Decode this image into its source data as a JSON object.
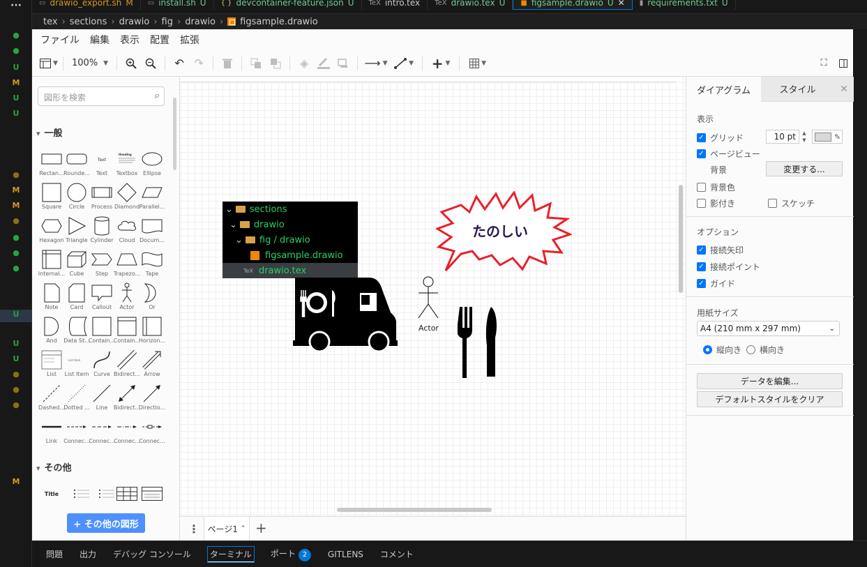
{
  "activity_bar": {
    "markers": [
      {
        "label": "●",
        "color": "#2ea043"
      },
      {
        "label": "●",
        "color": "#2ea043"
      },
      {
        "label": "U",
        "color": "#2ea043"
      },
      {
        "label": "M",
        "color": "#d29922"
      },
      {
        "label": "U",
        "color": "#2ea043"
      },
      {
        "label": "U",
        "color": "#2ea043"
      },
      {
        "label": "●",
        "color": "#8a6d1e"
      },
      {
        "label": "M",
        "color": "#d29922"
      },
      {
        "label": "M",
        "color": "#d29922"
      },
      {
        "label": "●",
        "color": "#8a6d1e"
      },
      {
        "label": "●",
        "color": "#2ea043"
      },
      {
        "label": "●",
        "color": "#2ea043"
      },
      {
        "label": "●",
        "color": "#2ea043"
      },
      {
        "label": "U",
        "color": "#2ea043"
      },
      {
        "label": "U",
        "color": "#2ea043"
      },
      {
        "label": "U",
        "color": "#2ea043"
      },
      {
        "label": "●",
        "color": "#8a6d1e"
      },
      {
        "label": "●",
        "color": "#8a6d1e"
      },
      {
        "label": "●",
        "color": "#8a6d1e"
      },
      {
        "label": "M",
        "color": "#d29922"
      }
    ],
    "more_label": "···"
  },
  "tabs": [
    {
      "icon": "shell-icon",
      "name": "drawio_export.sh",
      "status": "M",
      "color": "#d29922"
    },
    {
      "icon": "shell-icon",
      "name": "install.sh",
      "status": "U",
      "color": "#73c991"
    },
    {
      "icon": "json-icon",
      "name": "devcontainer-feature.json",
      "status": "U",
      "color": "#73c991"
    },
    {
      "icon": "tex-icon",
      "name": "intro.tex",
      "status": "",
      "color": "#cccccc"
    },
    {
      "icon": "tex-icon",
      "name": "drawio.tex",
      "status": "U",
      "color": "#73c991"
    },
    {
      "icon": "drawio-icon",
      "name": "figsample.drawio",
      "status": "U",
      "color": "#73c991",
      "active": true
    },
    {
      "icon": "txt-icon",
      "name": "requirements.txt",
      "status": "U",
      "color": "#73c991"
    }
  ],
  "breadcrumb": [
    "tex",
    "sections",
    "drawio",
    "fig",
    "drawio",
    "figsample.drawio"
  ],
  "menu": [
    "ファイル",
    "編集",
    "表示",
    "配置",
    "拡張"
  ],
  "toolbar": {
    "zoom": "100%"
  },
  "search": {
    "placeholder": "図形を検索"
  },
  "sections": {
    "general": "一般",
    "other": "その他"
  },
  "shapes": [
    "Rectan...",
    "Rounde...",
    "Text",
    "Textbox",
    "Ellipse",
    "Square",
    "Circle",
    "Process",
    "Diamond",
    "Parallel...",
    "Hexagon",
    "Triangle",
    "Cylinder",
    "Cloud",
    "Docum...",
    "Internal...",
    "Cube",
    "Step",
    "Trapezo...",
    "Tape",
    "Note",
    "Card",
    "Callout",
    "Actor",
    "Or",
    "And",
    "Data St...",
    "Contain...",
    "Contain...",
    "Horizon...",
    "List",
    "List Item",
    "Curve",
    "Bidirect...",
    "Arrow",
    "Dashed...",
    "Dotted ...",
    "Line",
    "Bidirect...",
    "Directio...",
    "Link",
    "Connec...",
    "Connec...",
    "Connec...",
    "Connec..."
  ],
  "other_shapes": [
    "Title"
  ],
  "more_shapes_label": "+ その他の図形",
  "canvas": {
    "explorer": [
      "sections",
      "drawio",
      "fig / drawio",
      "figsample.drawio",
      "drawio.tex"
    ],
    "bubble_text": "たのしい",
    "actor_label": "Actor"
  },
  "pagebar": {
    "page": "ページ1"
  },
  "right": {
    "tab_diagram": "ダイアグラム",
    "tab_style": "スタイル",
    "view_label": "表示",
    "grid": "グリッド",
    "grid_size": "10 pt",
    "page_view": "ページビュー",
    "background": "背景",
    "change": "変更する...",
    "bg_color": "背景色",
    "shadow": "影付き",
    "sketch": "スケッチ",
    "options_label": "オプション",
    "connection_arrows": "接続矢印",
    "connection_points": "接続ポイント",
    "guides": "ガイド",
    "paper_label": "用紙サイズ",
    "paper": "A4 (210 mm x 297 mm)",
    "portrait": "縦向き",
    "landscape": "横向き",
    "edit_data": "データを編集...",
    "clear_style": "デフォルトスタイルをクリア"
  },
  "statusbar": {
    "items": [
      "問題",
      "出力",
      "デバッグ コンソール",
      "ターミナル",
      "ポート",
      "GITLENS",
      "コメント"
    ],
    "ports_badge": "2"
  }
}
